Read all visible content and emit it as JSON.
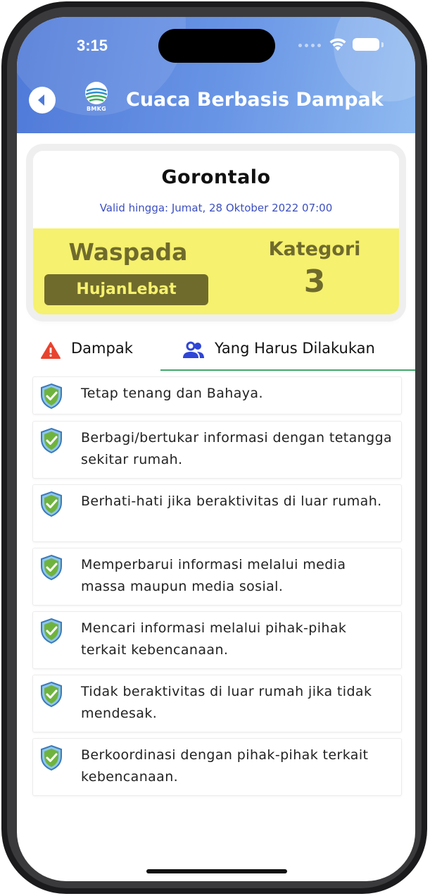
{
  "status_bar": {
    "time": "3:15"
  },
  "header": {
    "title": "Cuaca Berbasis Dampak",
    "logo_text": "BMKG"
  },
  "warning": {
    "city": "Gorontalo",
    "valid_until": "Valid hingga: Jumat, 28 Oktober 2022 07:00",
    "level": "Waspada",
    "hazard": "HujanLebat",
    "category_label": "Kategori",
    "category_value": "3"
  },
  "tabs": [
    {
      "label": "Dampak",
      "icon": "warning-icon",
      "selected": false
    },
    {
      "label": "Yang Harus Dilakukan",
      "icon": "people-icon",
      "selected": true
    }
  ],
  "actions": [
    "Tetap tenang dan Bahaya.",
    "Berbagi/bertukar informasi dengan tetangga sekitar rumah.",
    "Berhati-hati jika beraktivitas di luar rumah.",
    "Memperbarui informasi melalui media massa maupun media sosial.",
    "Mencari informasi melalui pihak-pihak terkait kebencanaan.",
    "Tidak beraktivitas di luar rumah jika tidak mendesak.",
    "Berkoordinasi dengan pihak-pihak terkait kebencanaan."
  ],
  "colors": {
    "header_gradient_start": "#4f79d8",
    "header_gradient_end": "#8fbaf0",
    "alert_yellow": "#f6f16e",
    "alert_text": "#6f6b2d",
    "valid_text": "#3c4fc0",
    "tab_underline": "#3fa86a",
    "warning_icon": "#e8432e",
    "people_icon": "#2f45d6"
  }
}
